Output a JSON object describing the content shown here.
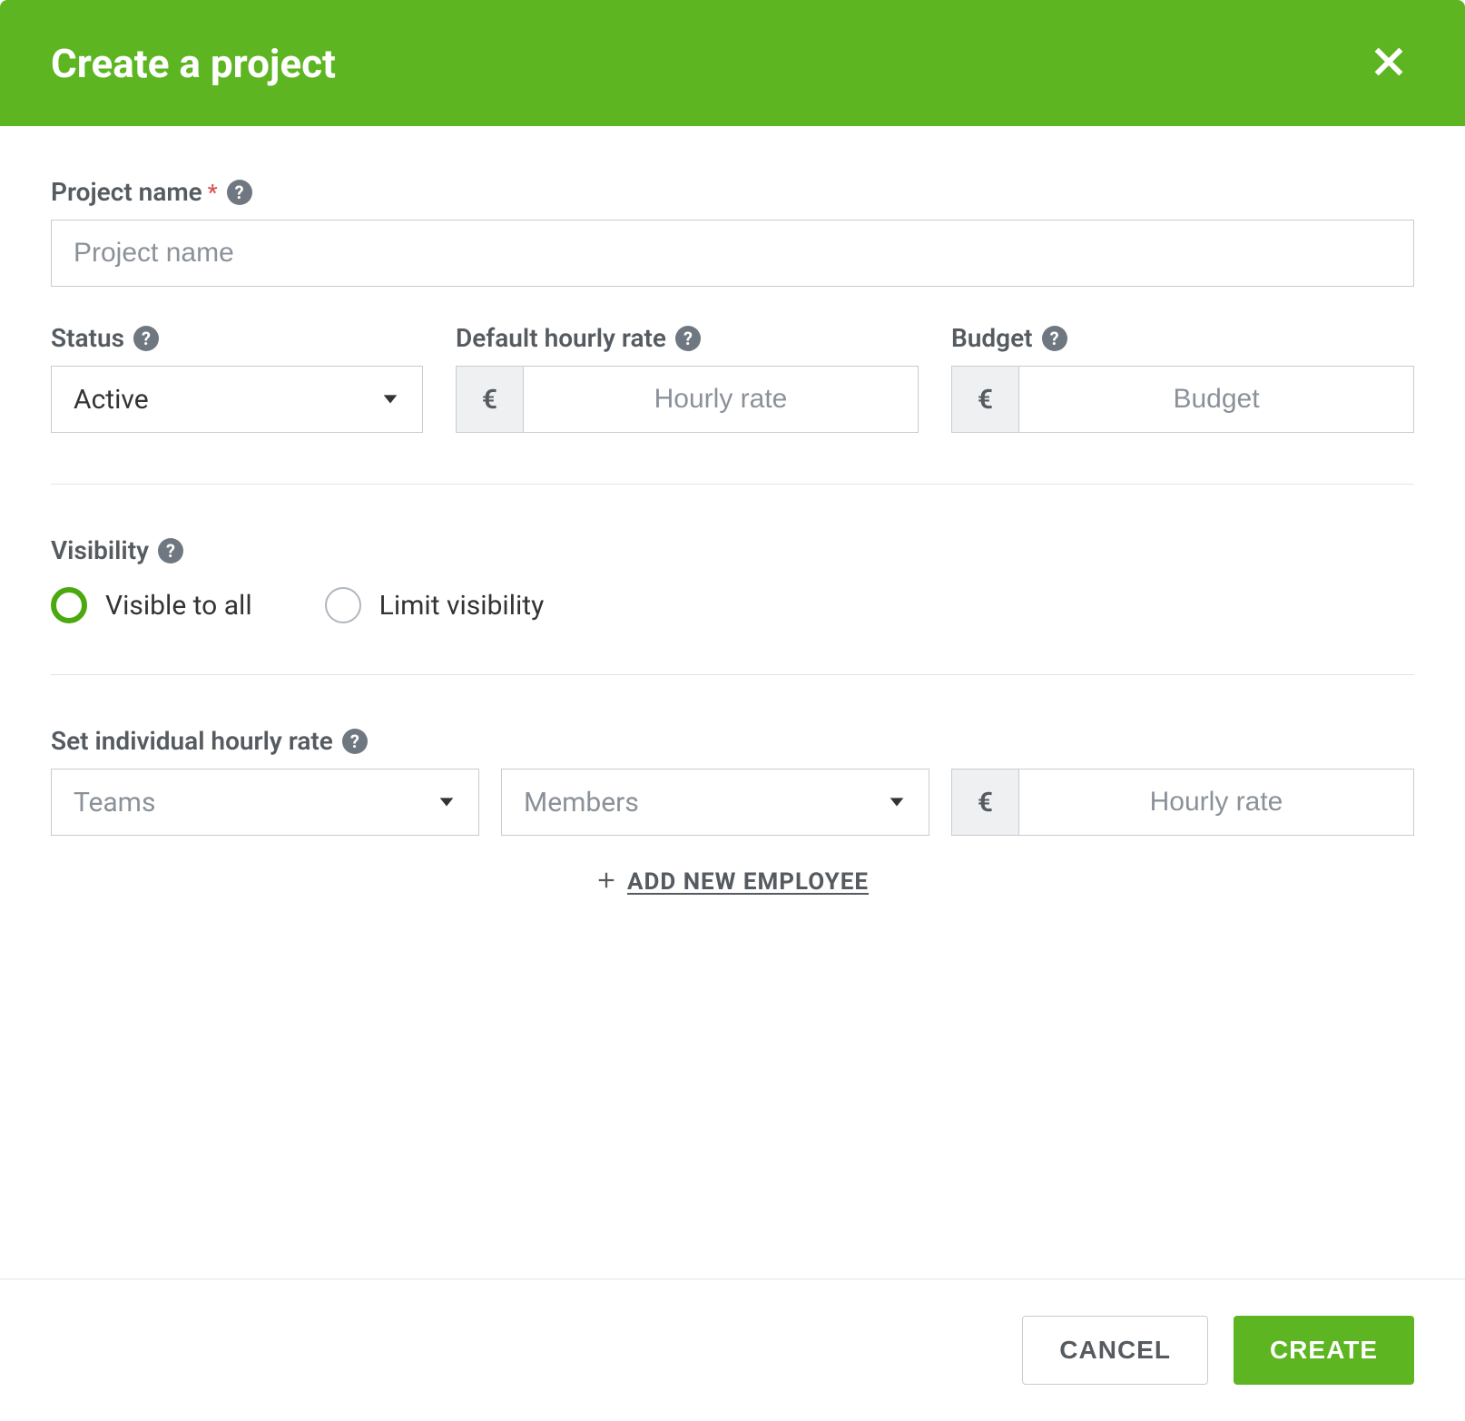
{
  "header": {
    "title": "Create a project"
  },
  "form": {
    "project_name": {
      "label": "Project name",
      "placeholder": "Project name"
    },
    "status": {
      "label": "Status",
      "value": "Active"
    },
    "default_hourly_rate": {
      "label": "Default hourly rate",
      "currency": "€",
      "placeholder": "Hourly rate"
    },
    "budget": {
      "label": "Budget",
      "currency": "€",
      "placeholder": "Budget"
    },
    "visibility": {
      "label": "Visibility",
      "options": {
        "visible_all": "Visible to all",
        "limit": "Limit visibility"
      },
      "selected": "visible_all"
    },
    "individual_rate": {
      "label": "Set individual hourly rate",
      "teams_placeholder": "Teams",
      "members_placeholder": "Members",
      "currency": "€",
      "rate_placeholder": "Hourly rate"
    },
    "add_employee_label": "ADD NEW EMPLOYEE"
  },
  "footer": {
    "cancel": "CANCEL",
    "create": "CREATE"
  },
  "help_symbol": "?"
}
